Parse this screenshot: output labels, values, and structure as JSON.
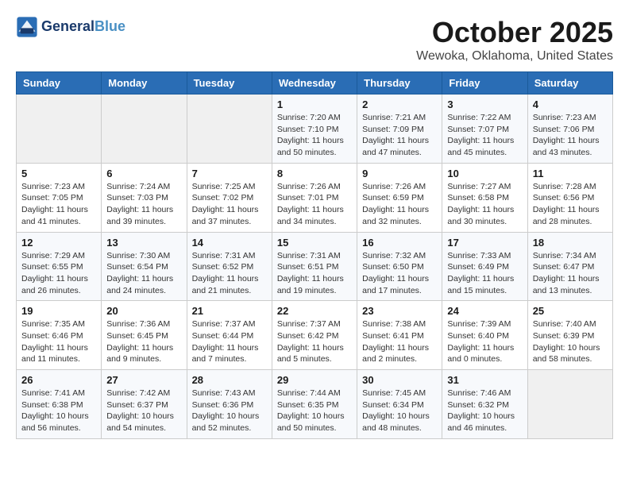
{
  "header": {
    "logo_line1": "General",
    "logo_line2": "Blue",
    "month_title": "October 2025",
    "location": "Wewoka, Oklahoma, United States"
  },
  "days_of_week": [
    "Sunday",
    "Monday",
    "Tuesday",
    "Wednesday",
    "Thursday",
    "Friday",
    "Saturday"
  ],
  "weeks": [
    [
      {
        "day": "",
        "info": ""
      },
      {
        "day": "",
        "info": ""
      },
      {
        "day": "",
        "info": ""
      },
      {
        "day": "1",
        "info": "Sunrise: 7:20 AM\nSunset: 7:10 PM\nDaylight: 11 hours\nand 50 minutes."
      },
      {
        "day": "2",
        "info": "Sunrise: 7:21 AM\nSunset: 7:09 PM\nDaylight: 11 hours\nand 47 minutes."
      },
      {
        "day": "3",
        "info": "Sunrise: 7:22 AM\nSunset: 7:07 PM\nDaylight: 11 hours\nand 45 minutes."
      },
      {
        "day": "4",
        "info": "Sunrise: 7:23 AM\nSunset: 7:06 PM\nDaylight: 11 hours\nand 43 minutes."
      }
    ],
    [
      {
        "day": "5",
        "info": "Sunrise: 7:23 AM\nSunset: 7:05 PM\nDaylight: 11 hours\nand 41 minutes."
      },
      {
        "day": "6",
        "info": "Sunrise: 7:24 AM\nSunset: 7:03 PM\nDaylight: 11 hours\nand 39 minutes."
      },
      {
        "day": "7",
        "info": "Sunrise: 7:25 AM\nSunset: 7:02 PM\nDaylight: 11 hours\nand 37 minutes."
      },
      {
        "day": "8",
        "info": "Sunrise: 7:26 AM\nSunset: 7:01 PM\nDaylight: 11 hours\nand 34 minutes."
      },
      {
        "day": "9",
        "info": "Sunrise: 7:26 AM\nSunset: 6:59 PM\nDaylight: 11 hours\nand 32 minutes."
      },
      {
        "day": "10",
        "info": "Sunrise: 7:27 AM\nSunset: 6:58 PM\nDaylight: 11 hours\nand 30 minutes."
      },
      {
        "day": "11",
        "info": "Sunrise: 7:28 AM\nSunset: 6:56 PM\nDaylight: 11 hours\nand 28 minutes."
      }
    ],
    [
      {
        "day": "12",
        "info": "Sunrise: 7:29 AM\nSunset: 6:55 PM\nDaylight: 11 hours\nand 26 minutes."
      },
      {
        "day": "13",
        "info": "Sunrise: 7:30 AM\nSunset: 6:54 PM\nDaylight: 11 hours\nand 24 minutes."
      },
      {
        "day": "14",
        "info": "Sunrise: 7:31 AM\nSunset: 6:52 PM\nDaylight: 11 hours\nand 21 minutes."
      },
      {
        "day": "15",
        "info": "Sunrise: 7:31 AM\nSunset: 6:51 PM\nDaylight: 11 hours\nand 19 minutes."
      },
      {
        "day": "16",
        "info": "Sunrise: 7:32 AM\nSunset: 6:50 PM\nDaylight: 11 hours\nand 17 minutes."
      },
      {
        "day": "17",
        "info": "Sunrise: 7:33 AM\nSunset: 6:49 PM\nDaylight: 11 hours\nand 15 minutes."
      },
      {
        "day": "18",
        "info": "Sunrise: 7:34 AM\nSunset: 6:47 PM\nDaylight: 11 hours\nand 13 minutes."
      }
    ],
    [
      {
        "day": "19",
        "info": "Sunrise: 7:35 AM\nSunset: 6:46 PM\nDaylight: 11 hours\nand 11 minutes."
      },
      {
        "day": "20",
        "info": "Sunrise: 7:36 AM\nSunset: 6:45 PM\nDaylight: 11 hours\nand 9 minutes."
      },
      {
        "day": "21",
        "info": "Sunrise: 7:37 AM\nSunset: 6:44 PM\nDaylight: 11 hours\nand 7 minutes."
      },
      {
        "day": "22",
        "info": "Sunrise: 7:37 AM\nSunset: 6:42 PM\nDaylight: 11 hours\nand 5 minutes."
      },
      {
        "day": "23",
        "info": "Sunrise: 7:38 AM\nSunset: 6:41 PM\nDaylight: 11 hours\nand 2 minutes."
      },
      {
        "day": "24",
        "info": "Sunrise: 7:39 AM\nSunset: 6:40 PM\nDaylight: 11 hours\nand 0 minutes."
      },
      {
        "day": "25",
        "info": "Sunrise: 7:40 AM\nSunset: 6:39 PM\nDaylight: 10 hours\nand 58 minutes."
      }
    ],
    [
      {
        "day": "26",
        "info": "Sunrise: 7:41 AM\nSunset: 6:38 PM\nDaylight: 10 hours\nand 56 minutes."
      },
      {
        "day": "27",
        "info": "Sunrise: 7:42 AM\nSunset: 6:37 PM\nDaylight: 10 hours\nand 54 minutes."
      },
      {
        "day": "28",
        "info": "Sunrise: 7:43 AM\nSunset: 6:36 PM\nDaylight: 10 hours\nand 52 minutes."
      },
      {
        "day": "29",
        "info": "Sunrise: 7:44 AM\nSunset: 6:35 PM\nDaylight: 10 hours\nand 50 minutes."
      },
      {
        "day": "30",
        "info": "Sunrise: 7:45 AM\nSunset: 6:34 PM\nDaylight: 10 hours\nand 48 minutes."
      },
      {
        "day": "31",
        "info": "Sunrise: 7:46 AM\nSunset: 6:32 PM\nDaylight: 10 hours\nand 46 minutes."
      },
      {
        "day": "",
        "info": ""
      }
    ]
  ]
}
